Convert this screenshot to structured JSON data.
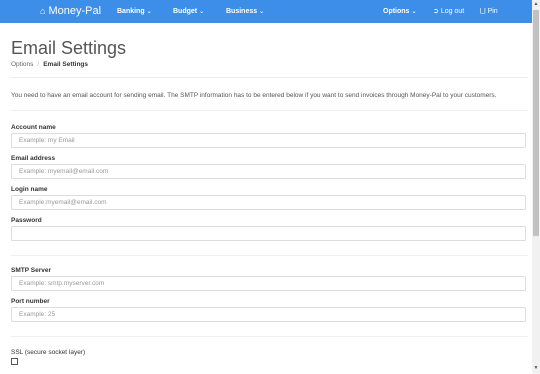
{
  "navbar": {
    "brand_icon": "home-icon",
    "brand": "Money-Pal",
    "menus": [
      {
        "label": "Banking",
        "icon": "chevron-down-icon"
      },
      {
        "label": "Budget",
        "icon": "chevron-down-icon"
      },
      {
        "label": "Business",
        "icon": "chevron-down-icon"
      }
    ],
    "options": "Options",
    "logout": "Log out",
    "logout_icon": "logout-icon",
    "pin": "Pin",
    "pin_icon": "pin-icon",
    "bg_color": "#3d8ee8"
  },
  "page": {
    "title": "Email Settings",
    "breadcrumb": [
      "Options",
      "Email Settings"
    ],
    "info": "You need to have an email account for sending email. The SMTP information has to be entered below if you want to send invoices through Money-Pal to your customers."
  },
  "form": {
    "account_name": {
      "label": "Account name",
      "placeholder": "Example: my Email",
      "value": ""
    },
    "email_address": {
      "label": "Email address",
      "placeholder": "Example: myemail@email.com",
      "value": ""
    },
    "login_name": {
      "label": "Login name",
      "placeholder": "Example:myemail@email.com",
      "value": ""
    },
    "password": {
      "label": "Password",
      "placeholder": "",
      "value": ""
    },
    "smtp_server": {
      "label": "SMTP Server",
      "placeholder": "Example: smtp.myserver.com",
      "value": ""
    },
    "port_number": {
      "label": "Port number",
      "placeholder": "Example: 25",
      "value": ""
    },
    "ssl": {
      "label": "SSL (secure socket layer)",
      "checked": false
    }
  }
}
